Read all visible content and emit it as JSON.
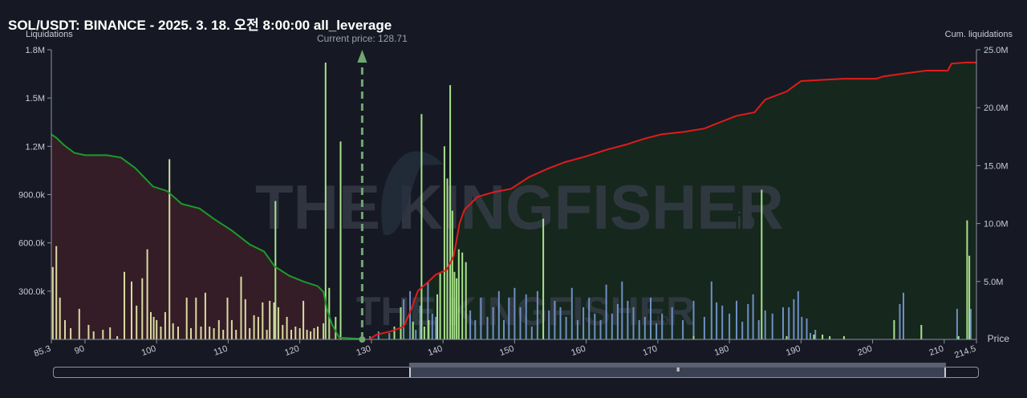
{
  "chart_data": {
    "type": "bar",
    "title": "SOL/USDT: BINANCE - 2025. 3. 18. 오전 8:00:00 all_leverage",
    "ylabel_left": "Liquidations",
    "ylabel_right": "Cum. liquidations",
    "xlabel": "Price",
    "xlim": [
      85.3,
      214.5
    ],
    "ylim_left": [
      0,
      1800000
    ],
    "ylim_right": [
      0,
      25000000
    ],
    "x_ticks": [
      "85.3",
      "90",
      "100",
      "110",
      "120",
      "130",
      "140",
      "150",
      "160",
      "170",
      "180",
      "190",
      "200",
      "210",
      "214.5"
    ],
    "x_tick_values": [
      85.3,
      90,
      100,
      110,
      120,
      130,
      140,
      150,
      160,
      170,
      180,
      190,
      200,
      210,
      214.5
    ],
    "y_left_ticks": [
      "300.0k",
      "600.0k",
      "900.0k",
      "1.2M",
      "1.5M",
      "1.8M"
    ],
    "y_left_tick_values": [
      300000,
      600000,
      900000,
      1200000,
      1500000,
      1800000
    ],
    "y_right_ticks": [
      "5.0M",
      "10.0M",
      "15.0M",
      "20.0M",
      "25.0M"
    ],
    "y_right_tick_values": [
      5000000,
      10000000,
      15000000,
      20000000,
      25000000
    ],
    "current_price": 128.71,
    "current_price_label": "Current price: 128.71",
    "watermark": "THE KINGFISHER",
    "watermark_suffix": "io",
    "colors": {
      "long_bar": "#d9dba0",
      "short_bar_green": "#a8e28a",
      "short_bar_blue": "#6f8fc4",
      "long_cum_line": "#1c9a2a",
      "long_cum_fill": "#3a1e28",
      "short_cum_line": "#e21b1b",
      "short_cum_fill": "#16281f",
      "current_price_line": "#6fa86f",
      "axis_text": "#c8ccd6"
    },
    "series": [
      {
        "name": "long_liquidations",
        "color": "#d9dba0",
        "points": [
          [
            85.5,
            450000
          ],
          [
            86.0,
            580000
          ],
          [
            86.5,
            260000
          ],
          [
            87.2,
            120000
          ],
          [
            88.0,
            70000
          ],
          [
            89.2,
            190000
          ],
          [
            90.5,
            90000
          ],
          [
            91.2,
            50000
          ],
          [
            92.5,
            60000
          ],
          [
            93.5,
            75000
          ],
          [
            94.5,
            20000
          ],
          [
            95.5,
            420000
          ],
          [
            96.5,
            360000
          ],
          [
            97.2,
            210000
          ],
          [
            98.0,
            380000
          ],
          [
            98.7,
            560000
          ],
          [
            99.2,
            170000
          ],
          [
            99.6,
            140000
          ],
          [
            100.0,
            120000
          ],
          [
            100.6,
            80000
          ],
          [
            101.2,
            170000
          ],
          [
            101.8,
            1120000
          ],
          [
            102.3,
            100000
          ],
          [
            103.0,
            80000
          ],
          [
            104.2,
            260000
          ],
          [
            104.8,
            70000
          ],
          [
            105.5,
            260000
          ],
          [
            106.2,
            80000
          ],
          [
            106.8,
            290000
          ],
          [
            107.4,
            80000
          ],
          [
            108.0,
            70000
          ],
          [
            108.7,
            120000
          ],
          [
            109.3,
            60000
          ],
          [
            109.9,
            260000
          ],
          [
            110.5,
            120000
          ],
          [
            111.1,
            60000
          ],
          [
            111.8,
            390000
          ],
          [
            112.4,
            250000
          ],
          [
            113.0,
            70000
          ],
          [
            113.6,
            150000
          ],
          [
            114.2,
            140000
          ],
          [
            114.8,
            230000
          ],
          [
            115.4,
            60000
          ],
          [
            115.8,
            240000
          ],
          [
            116.4,
            230000
          ],
          [
            117.0,
            200000
          ],
          [
            117.6,
            90000
          ],
          [
            118.2,
            140000
          ],
          [
            118.8,
            60000
          ],
          [
            119.4,
            80000
          ],
          [
            120.0,
            70000
          ],
          [
            120.5,
            240000
          ],
          [
            121.0,
            60000
          ],
          [
            121.5,
            50000
          ],
          [
            122.0,
            70000
          ],
          [
            122.5,
            80000
          ]
        ]
      },
      {
        "name": "short_liquidations_green",
        "color": "#a8e28a",
        "points": [
          [
            116.6,
            860000
          ],
          [
            123.3,
            100000
          ],
          [
            123.6,
            1720000
          ],
          [
            124.1,
            320000
          ],
          [
            125.0,
            140000
          ],
          [
            125.7,
            1230000
          ],
          [
            133.2,
            80000
          ],
          [
            134.1,
            200000
          ],
          [
            135.8,
            110000
          ],
          [
            137.0,
            1400000
          ],
          [
            137.4,
            80000
          ],
          [
            138.0,
            120000
          ],
          [
            139.2,
            280000
          ],
          [
            139.6,
            410000
          ],
          [
            140.2,
            1200000
          ],
          [
            140.6,
            1000000
          ],
          [
            141.0,
            1580000
          ],
          [
            141.3,
            800000
          ],
          [
            141.6,
            420000
          ],
          [
            141.9,
            380000
          ],
          [
            142.2,
            560000
          ],
          [
            142.7,
            540000
          ],
          [
            143.2,
            480000
          ],
          [
            154.0,
            750000
          ],
          [
            175.0,
            20000
          ],
          [
            184.5,
            930000
          ],
          [
            188.0,
            20000
          ],
          [
            191.8,
            30000
          ],
          [
            193.0,
            30000
          ],
          [
            194.0,
            20000
          ],
          [
            196.0,
            20000
          ],
          [
            203.0,
            120000
          ],
          [
            206.8,
            90000
          ],
          [
            212.0,
            20000
          ],
          [
            213.2,
            740000
          ],
          [
            213.5,
            520000
          ]
        ]
      },
      {
        "name": "short_liquidations_blue",
        "color": "#6f8fc4",
        "points": [
          [
            129.8,
            20000
          ],
          [
            131.0,
            50000
          ],
          [
            132.5,
            40000
          ],
          [
            134.5,
            250000
          ],
          [
            135.4,
            300000
          ],
          [
            136.2,
            60000
          ],
          [
            136.8,
            210000
          ],
          [
            137.9,
            360000
          ],
          [
            138.5,
            160000
          ],
          [
            139.0,
            140000
          ],
          [
            143.8,
            180000
          ],
          [
            144.5,
            120000
          ],
          [
            145.3,
            260000
          ],
          [
            146.2,
            140000
          ],
          [
            147.0,
            200000
          ],
          [
            147.8,
            300000
          ],
          [
            148.5,
            120000
          ],
          [
            149.2,
            260000
          ],
          [
            150.0,
            320000
          ],
          [
            150.8,
            200000
          ],
          [
            151.6,
            280000
          ],
          [
            152.4,
            80000
          ],
          [
            153.2,
            300000
          ],
          [
            154.8,
            180000
          ],
          [
            155.6,
            240000
          ],
          [
            156.4,
            200000
          ],
          [
            157.2,
            140000
          ],
          [
            158.0,
            320000
          ],
          [
            158.8,
            120000
          ],
          [
            159.6,
            200000
          ],
          [
            160.4,
            260000
          ],
          [
            161.2,
            160000
          ],
          [
            162.0,
            120000
          ],
          [
            162.8,
            340000
          ],
          [
            163.6,
            160000
          ],
          [
            164.4,
            220000
          ],
          [
            165.0,
            360000
          ],
          [
            165.8,
            240000
          ],
          [
            166.6,
            200000
          ],
          [
            167.4,
            120000
          ],
          [
            168.2,
            140000
          ],
          [
            169.0,
            260000
          ],
          [
            169.8,
            100000
          ],
          [
            170.6,
            160000
          ],
          [
            172.0,
            200000
          ],
          [
            173.5,
            120000
          ],
          [
            175.0,
            240000
          ],
          [
            176.5,
            140000
          ],
          [
            177.5,
            360000
          ],
          [
            178.2,
            230000
          ],
          [
            179.0,
            210000
          ],
          [
            180.0,
            160000
          ],
          [
            181.0,
            240000
          ],
          [
            181.8,
            110000
          ],
          [
            182.6,
            220000
          ],
          [
            183.3,
            280000
          ],
          [
            184.1,
            120000
          ],
          [
            185.0,
            180000
          ],
          [
            186.0,
            160000
          ],
          [
            187.5,
            200000
          ],
          [
            188.3,
            200000
          ],
          [
            189.0,
            250000
          ],
          [
            189.6,
            300000
          ],
          [
            190.1,
            140000
          ],
          [
            190.8,
            130000
          ],
          [
            191.3,
            40000
          ],
          [
            192.0,
            60000
          ],
          [
            203.8,
            220000
          ],
          [
            204.3,
            290000
          ],
          [
            211.8,
            190000
          ],
          [
            213.7,
            190000
          ]
        ]
      },
      {
        "name": "long_cumulative",
        "color": "#1c9a2a",
        "points": [
          [
            85.3,
            17700000
          ],
          [
            86.0,
            17400000
          ],
          [
            87.0,
            16800000
          ],
          [
            88.5,
            16100000
          ],
          [
            90.0,
            15900000
          ],
          [
            93.0,
            15900000
          ],
          [
            95.0,
            15700000
          ],
          [
            97.0,
            14800000
          ],
          [
            99.5,
            13200000
          ],
          [
            101.5,
            12800000
          ],
          [
            103.5,
            11700000
          ],
          [
            106.0,
            11300000
          ],
          [
            108.0,
            10400000
          ],
          [
            110.5,
            9400000
          ],
          [
            113.0,
            8200000
          ],
          [
            115.0,
            7600000
          ],
          [
            116.5,
            6300000
          ],
          [
            118.5,
            5500000
          ],
          [
            120.5,
            5000000
          ],
          [
            122.5,
            4600000
          ],
          [
            123.3,
            4100000
          ],
          [
            123.8,
            2600000
          ],
          [
            124.5,
            1300000
          ],
          [
            125.5,
            150000
          ],
          [
            128.5,
            50000
          ]
        ]
      },
      {
        "name": "short_cumulative",
        "color": "#e21b1b",
        "points": [
          [
            129.7,
            20000
          ],
          [
            130.7,
            400000
          ],
          [
            133.0,
            750000
          ],
          [
            134.5,
            1100000
          ],
          [
            135.5,
            2500000
          ],
          [
            136.5,
            4200000
          ],
          [
            138.0,
            5000000
          ],
          [
            139.0,
            5600000
          ],
          [
            140.5,
            6000000
          ],
          [
            141.5,
            7200000
          ],
          [
            142.3,
            10000000
          ],
          [
            143.0,
            11200000
          ],
          [
            144.8,
            12300000
          ],
          [
            147.0,
            12700000
          ],
          [
            149.5,
            13000000
          ],
          [
            152.0,
            14000000
          ],
          [
            154.5,
            14700000
          ],
          [
            157.0,
            15300000
          ],
          [
            160.0,
            15800000
          ],
          [
            163.0,
            16400000
          ],
          [
            165.5,
            16800000
          ],
          [
            168.0,
            17300000
          ],
          [
            170.5,
            17700000
          ],
          [
            173.5,
            17900000
          ],
          [
            176.5,
            18200000
          ],
          [
            178.5,
            18700000
          ],
          [
            181.0,
            19300000
          ],
          [
            183.5,
            19600000
          ],
          [
            185.0,
            20700000
          ],
          [
            188.0,
            21400000
          ],
          [
            190.0,
            22300000
          ],
          [
            193.0,
            22400000
          ],
          [
            196.0,
            22500000
          ],
          [
            200.5,
            22500000
          ],
          [
            201.5,
            22700000
          ],
          [
            205.0,
            23000000
          ],
          [
            207.5,
            23200000
          ],
          [
            210.5,
            23200000
          ],
          [
            211.0,
            23800000
          ],
          [
            213.0,
            23900000
          ],
          [
            214.5,
            23900000
          ]
        ]
      }
    ],
    "legend_placement": "none",
    "grid": false
  },
  "scrollbar": {
    "grip": "III"
  }
}
